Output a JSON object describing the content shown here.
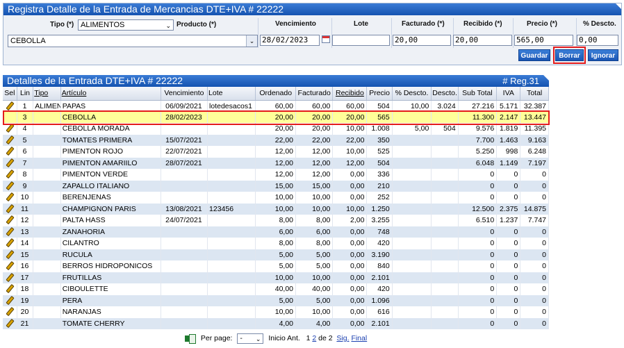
{
  "form": {
    "title": "Registra Detalle de la Entrada de Mercancias DTE+IVA # 22222",
    "tipo_label": "Tipo (*)",
    "tipo_value": "ALIMENTOS",
    "producto_label": "Producto (*)",
    "producto_value": "CEBOLLA",
    "headers": {
      "vencimiento": "Vencimiento",
      "lote": "Lote",
      "facturado": "Facturado (*)",
      "recibido": "Recibido (*)",
      "precio": "Precio (*)",
      "descto": "% Descto."
    },
    "values": {
      "vencimiento": "28/02/2023",
      "lote": "",
      "facturado": "20,00",
      "recibido": "20,00",
      "precio": "565,00",
      "descto": "0,00"
    },
    "buttons": {
      "guardar": "Guardar",
      "borrar": "Borrar",
      "ignorar": "Ignorar"
    }
  },
  "grid": {
    "title": "Detalles de la Entrada DTE+IVA # 22222",
    "reg_count": "# Reg.31",
    "columns": [
      "Sel",
      "Lin",
      "Tipo",
      "Artículo",
      "Vencimiento",
      "Lote",
      "Ordenado",
      "Facturado",
      "Recibido",
      "Precio",
      "% Descto.",
      "Descto.",
      "Sub Total",
      "IVA",
      "Total"
    ],
    "rows": [
      {
        "lin": "1",
        "tipo": "ALIMENTOS",
        "articulo": "PAPAS",
        "venc": "06/09/2021",
        "lote": "lotedesacos1",
        "ordenado": "60,00",
        "facturado": "60,00",
        "recibido": "60,00",
        "precio": "504",
        "pdescto": "10,00",
        "descto": "3.024",
        "subtotal": "27.216",
        "iva": "5.171",
        "total": "32.387"
      },
      {
        "lin": "3",
        "tipo": "",
        "articulo": "CEBOLLA",
        "venc": "28/02/2023",
        "lote": "",
        "ordenado": "20,00",
        "facturado": "20,00",
        "recibido": "20,00",
        "precio": "565",
        "pdescto": "",
        "descto": "",
        "subtotal": "11.300",
        "iva": "2.147",
        "total": "13.447"
      },
      {
        "lin": "4",
        "tipo": "",
        "articulo": "CEBOLLA MORADA",
        "venc": "",
        "lote": "",
        "ordenado": "20,00",
        "facturado": "20,00",
        "recibido": "10,00",
        "precio": "1.008",
        "pdescto": "5,00",
        "descto": "504",
        "subtotal": "9.576",
        "iva": "1.819",
        "total": "11.395"
      },
      {
        "lin": "5",
        "tipo": "",
        "articulo": "TOMATES PRIMERA",
        "venc": "15/07/2021",
        "lote": "",
        "ordenado": "22,00",
        "facturado": "22,00",
        "recibido": "22,00",
        "precio": "350",
        "pdescto": "",
        "descto": "",
        "subtotal": "7.700",
        "iva": "1.463",
        "total": "9.163"
      },
      {
        "lin": "6",
        "tipo": "",
        "articulo": "PIMENTON ROJO",
        "venc": "22/07/2021",
        "lote": "",
        "ordenado": "12,00",
        "facturado": "12,00",
        "recibido": "10,00",
        "precio": "525",
        "pdescto": "",
        "descto": "",
        "subtotal": "5.250",
        "iva": "998",
        "total": "6.248"
      },
      {
        "lin": "7",
        "tipo": "",
        "articulo": "PIMENTON AMARIILO",
        "venc": "28/07/2021",
        "lote": "",
        "ordenado": "12,00",
        "facturado": "12,00",
        "recibido": "12,00",
        "precio": "504",
        "pdescto": "",
        "descto": "",
        "subtotal": "6.048",
        "iva": "1.149",
        "total": "7.197"
      },
      {
        "lin": "8",
        "tipo": "",
        "articulo": "PIMENTON VERDE",
        "venc": "",
        "lote": "",
        "ordenado": "12,00",
        "facturado": "12,00",
        "recibido": "0,00",
        "precio": "336",
        "pdescto": "",
        "descto": "",
        "subtotal": "0",
        "iva": "0",
        "total": "0"
      },
      {
        "lin": "9",
        "tipo": "",
        "articulo": "ZAPALLO ITALIANO",
        "venc": "",
        "lote": "",
        "ordenado": "15,00",
        "facturado": "15,00",
        "recibido": "0,00",
        "precio": "210",
        "pdescto": "",
        "descto": "",
        "subtotal": "0",
        "iva": "0",
        "total": "0"
      },
      {
        "lin": "10",
        "tipo": "",
        "articulo": "BERENJENAS",
        "venc": "",
        "lote": "",
        "ordenado": "10,00",
        "facturado": "10,00",
        "recibido": "0,00",
        "precio": "252",
        "pdescto": "",
        "descto": "",
        "subtotal": "0",
        "iva": "0",
        "total": "0"
      },
      {
        "lin": "11",
        "tipo": "",
        "articulo": "CHAMPIGNON PARIS",
        "venc": "13/08/2021",
        "lote": "123456",
        "ordenado": "10,00",
        "facturado": "10,00",
        "recibido": "10,00",
        "precio": "1.250",
        "pdescto": "",
        "descto": "",
        "subtotal": "12.500",
        "iva": "2.375",
        "total": "14.875"
      },
      {
        "lin": "12",
        "tipo": "",
        "articulo": "PALTA HASS",
        "venc": "24/07/2021",
        "lote": "",
        "ordenado": "8,00",
        "facturado": "8,00",
        "recibido": "2,00",
        "precio": "3.255",
        "pdescto": "",
        "descto": "",
        "subtotal": "6.510",
        "iva": "1.237",
        "total": "7.747"
      },
      {
        "lin": "13",
        "tipo": "",
        "articulo": "ZANAHORIA",
        "venc": "",
        "lote": "",
        "ordenado": "6,00",
        "facturado": "6,00",
        "recibido": "0,00",
        "precio": "748",
        "pdescto": "",
        "descto": "",
        "subtotal": "0",
        "iva": "0",
        "total": "0"
      },
      {
        "lin": "14",
        "tipo": "",
        "articulo": "CILANTRO",
        "venc": "",
        "lote": "",
        "ordenado": "8,00",
        "facturado": "8,00",
        "recibido": "0,00",
        "precio": "420",
        "pdescto": "",
        "descto": "",
        "subtotal": "0",
        "iva": "0",
        "total": "0"
      },
      {
        "lin": "15",
        "tipo": "",
        "articulo": "RUCULA",
        "venc": "",
        "lote": "",
        "ordenado": "5,00",
        "facturado": "5,00",
        "recibido": "0,00",
        "precio": "3.190",
        "pdescto": "",
        "descto": "",
        "subtotal": "0",
        "iva": "0",
        "total": "0"
      },
      {
        "lin": "16",
        "tipo": "",
        "articulo": "BERROS HIDROPONICOS",
        "venc": "",
        "lote": "",
        "ordenado": "5,00",
        "facturado": "5,00",
        "recibido": "0,00",
        "precio": "840",
        "pdescto": "",
        "descto": "",
        "subtotal": "0",
        "iva": "0",
        "total": "0"
      },
      {
        "lin": "17",
        "tipo": "",
        "articulo": "FRUTILLAS",
        "venc": "",
        "lote": "",
        "ordenado": "10,00",
        "facturado": "10,00",
        "recibido": "0,00",
        "precio": "2.101",
        "pdescto": "",
        "descto": "",
        "subtotal": "0",
        "iva": "0",
        "total": "0"
      },
      {
        "lin": "18",
        "tipo": "",
        "articulo": "CIBOULETTE",
        "venc": "",
        "lote": "",
        "ordenado": "40,00",
        "facturado": "40,00",
        "recibido": "0,00",
        "precio": "420",
        "pdescto": "",
        "descto": "",
        "subtotal": "0",
        "iva": "0",
        "total": "0"
      },
      {
        "lin": "19",
        "tipo": "",
        "articulo": "PERA",
        "venc": "",
        "lote": "",
        "ordenado": "5,00",
        "facturado": "5,00",
        "recibido": "0,00",
        "precio": "1.096",
        "pdescto": "",
        "descto": "",
        "subtotal": "0",
        "iva": "0",
        "total": "0"
      },
      {
        "lin": "20",
        "tipo": "",
        "articulo": "NARANJAS",
        "venc": "",
        "lote": "",
        "ordenado": "10,00",
        "facturado": "10,00",
        "recibido": "0,00",
        "precio": "616",
        "pdescto": "",
        "descto": "",
        "subtotal": "0",
        "iva": "0",
        "total": "0"
      },
      {
        "lin": "21",
        "tipo": "",
        "articulo": "TOMATE CHERRY",
        "venc": "",
        "lote": "",
        "ordenado": "4,00",
        "facturado": "4,00",
        "recibido": "0,00",
        "precio": "2.101",
        "pdescto": "",
        "descto": "",
        "subtotal": "0",
        "iva": "0",
        "total": "0"
      }
    ],
    "selected_lin": "3"
  },
  "pager": {
    "export_icon": "excel-export-icon",
    "per_page_label": "Per page:",
    "per_page_value": "-",
    "inicio_ant": "Inicio Ant.",
    "page_1": "1",
    "page_2": "2",
    "de": "de 2",
    "sig": "Sig.",
    "final": "Final"
  },
  "colors": {
    "header_blue": "#1553b0",
    "row_alt": "#dce6f2",
    "selected_row": "#ffff99",
    "highlight_red": "#e41b1b"
  }
}
